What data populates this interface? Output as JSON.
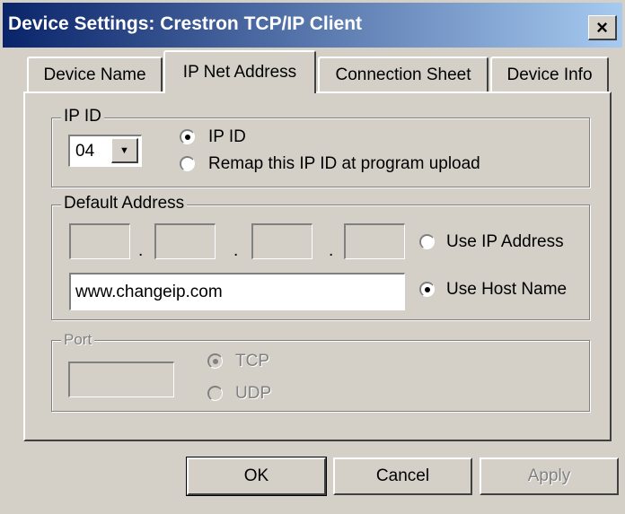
{
  "window": {
    "title": "Device Settings: Crestron TCP/IP Client",
    "close_label": "×"
  },
  "tabs": [
    {
      "label": "Device Name",
      "active": false
    },
    {
      "label": "IP Net Address",
      "active": true
    },
    {
      "label": "Connection Sheet",
      "active": false
    },
    {
      "label": "Device Info",
      "active": false
    }
  ],
  "ip_id": {
    "legend": "IP ID",
    "value": "04",
    "dropdown_arrow": "▼",
    "radio_ip_id": "IP ID",
    "radio_remap": "Remap this IP ID at program upload",
    "selected": "IP ID"
  },
  "default_address": {
    "legend": "Default Address",
    "separator": ".",
    "octets": [
      "",
      "",
      "",
      ""
    ],
    "radio_use_ip": "Use IP Address",
    "radio_use_host": "Use Host Name",
    "host_name": "www.changeip.com",
    "selected": "Use Host Name"
  },
  "port": {
    "legend": "Port",
    "value": "",
    "radio_tcp": "TCP",
    "radio_udp": "UDP",
    "selected": "TCP",
    "enabled": false
  },
  "buttons": {
    "ok": "OK",
    "cancel": "Cancel",
    "apply": "Apply"
  }
}
